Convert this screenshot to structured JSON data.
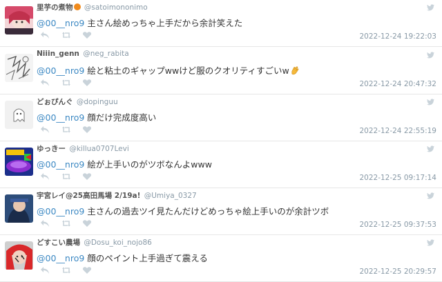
{
  "tweets": [
    {
      "name": "里芋の煮物",
      "has_emoji": true,
      "emoji_color": "#f08a1c",
      "handle": "@satoimononimo",
      "mention": "@00__nro9",
      "text": "主さん絵めっちゃ上手だから余計笑えた",
      "trailing_emoji": "",
      "timestamp": "2022-12-24 19:22:03"
    },
    {
      "name": "Niiin_genn",
      "has_emoji": false,
      "handle": "@neg_rabita",
      "mention": "@00__nro9",
      "text": "絵と粘土のギャップwwけど服のクオリティすごいw",
      "trailing_emoji": "clapping-hands-emoji",
      "timestamp": "2022-12-24 20:47:32"
    },
    {
      "name": "どぉぴんぐ",
      "has_emoji": false,
      "handle": "@dopinguu",
      "mention": "@00__nro9",
      "text": "顔だけ完成度高い",
      "trailing_emoji": "",
      "timestamp": "2022-12-24 22:55:19"
    },
    {
      "name": "ゆっきー",
      "has_emoji": false,
      "handle": "@killua0707Levi",
      "mention": "@00__nro9",
      "text": "絵が上手いのがツボなんよwww",
      "trailing_emoji": "",
      "timestamp": "2022-12-25 09:17:14"
    },
    {
      "name": "宇宮レイ@25高田馬場 2/19a!",
      "has_emoji": false,
      "handle": "@Umiya_0327",
      "mention": "@00__nro9",
      "text": "主さんの過去ツイ見たんだけどめっちゃ絵上手いのが余計ツボ",
      "trailing_emoji": "",
      "timestamp": "2022-12-25 09:37:53"
    },
    {
      "name": "どすこい農場",
      "has_emoji": false,
      "handle": "@Dosu_koi_nojo86",
      "mention": "@00__nro9",
      "text": "顔のペイント上手過ぎて震える",
      "trailing_emoji": "",
      "timestamp": "2022-12-25 20:29:57"
    }
  ],
  "colors": {
    "mention": "#3b88c3",
    "muted": "#8899a6",
    "action_icon": "#c9d3da",
    "twitter_bird": "#c9d3da",
    "separator": "#e6e6e6"
  },
  "icons": {
    "reply": "reply-icon",
    "retweet": "retweet-icon",
    "like": "heart-icon",
    "source": "twitter-bird-icon"
  }
}
